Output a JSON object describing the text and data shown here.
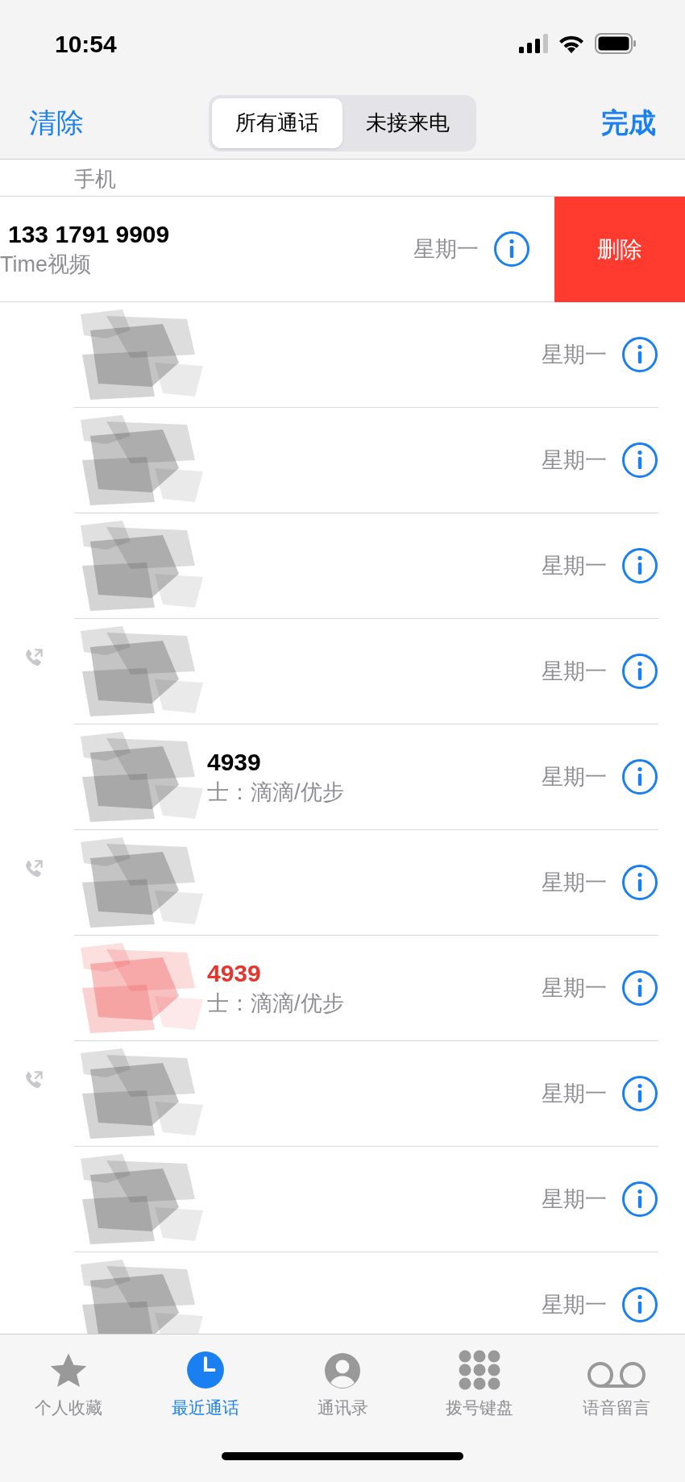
{
  "status_bar": {
    "time": "10:54"
  },
  "nav": {
    "left_button": "清除",
    "right_button": "完成",
    "segments": [
      {
        "label": "所有通话",
        "selected": true
      },
      {
        "label": "未接来电",
        "selected": false
      }
    ]
  },
  "calls": [
    {
      "kind": "partial",
      "subtitle": "手机"
    },
    {
      "kind": "call",
      "title": "133 1791 9909",
      "subtitle": "Time视频",
      "date": "星期一",
      "swiped": true,
      "action": "删除",
      "missed": false,
      "outgoing": false,
      "redacted": false
    },
    {
      "kind": "call",
      "date": "星期一",
      "swiped": false,
      "missed": false,
      "outgoing": false,
      "redacted": true
    },
    {
      "kind": "call",
      "date": "星期一",
      "swiped": false,
      "missed": false,
      "outgoing": false,
      "redacted": true
    },
    {
      "kind": "call",
      "date": "星期一",
      "swiped": false,
      "missed": false,
      "outgoing": false,
      "redacted": true
    },
    {
      "kind": "call",
      "date": "星期一",
      "swiped": false,
      "missed": false,
      "outgoing": true,
      "redacted": true
    },
    {
      "kind": "call",
      "title": "4939",
      "subtitle": "士：滴滴/优步",
      "date": "星期一",
      "swiped": false,
      "missed": false,
      "outgoing": false,
      "redacted": true
    },
    {
      "kind": "call",
      "date": "星期一",
      "swiped": false,
      "missed": false,
      "outgoing": true,
      "redacted": true
    },
    {
      "kind": "call",
      "title": "4939",
      "subtitle": "士：滴滴/优步",
      "date": "星期一",
      "swiped": false,
      "missed": true,
      "outgoing": false,
      "redacted": true
    },
    {
      "kind": "call",
      "date": "星期一",
      "swiped": false,
      "missed": false,
      "outgoing": true,
      "redacted": true
    },
    {
      "kind": "call",
      "date": "星期一",
      "swiped": false,
      "missed": false,
      "outgoing": false,
      "redacted": true
    },
    {
      "kind": "call",
      "date": "星期一",
      "swiped": false,
      "missed": false,
      "outgoing": false,
      "redacted": true
    }
  ],
  "tab_bar": [
    {
      "label": "个人收藏",
      "kind": "star",
      "selected": false
    },
    {
      "label": "最近通话",
      "kind": "clock",
      "selected": true
    },
    {
      "label": "通讯录",
      "kind": "person",
      "selected": false
    },
    {
      "label": "拨号键盘",
      "kind": "keypad",
      "selected": false
    },
    {
      "label": "语音留言",
      "kind": "voicemail",
      "selected": false
    }
  ]
}
